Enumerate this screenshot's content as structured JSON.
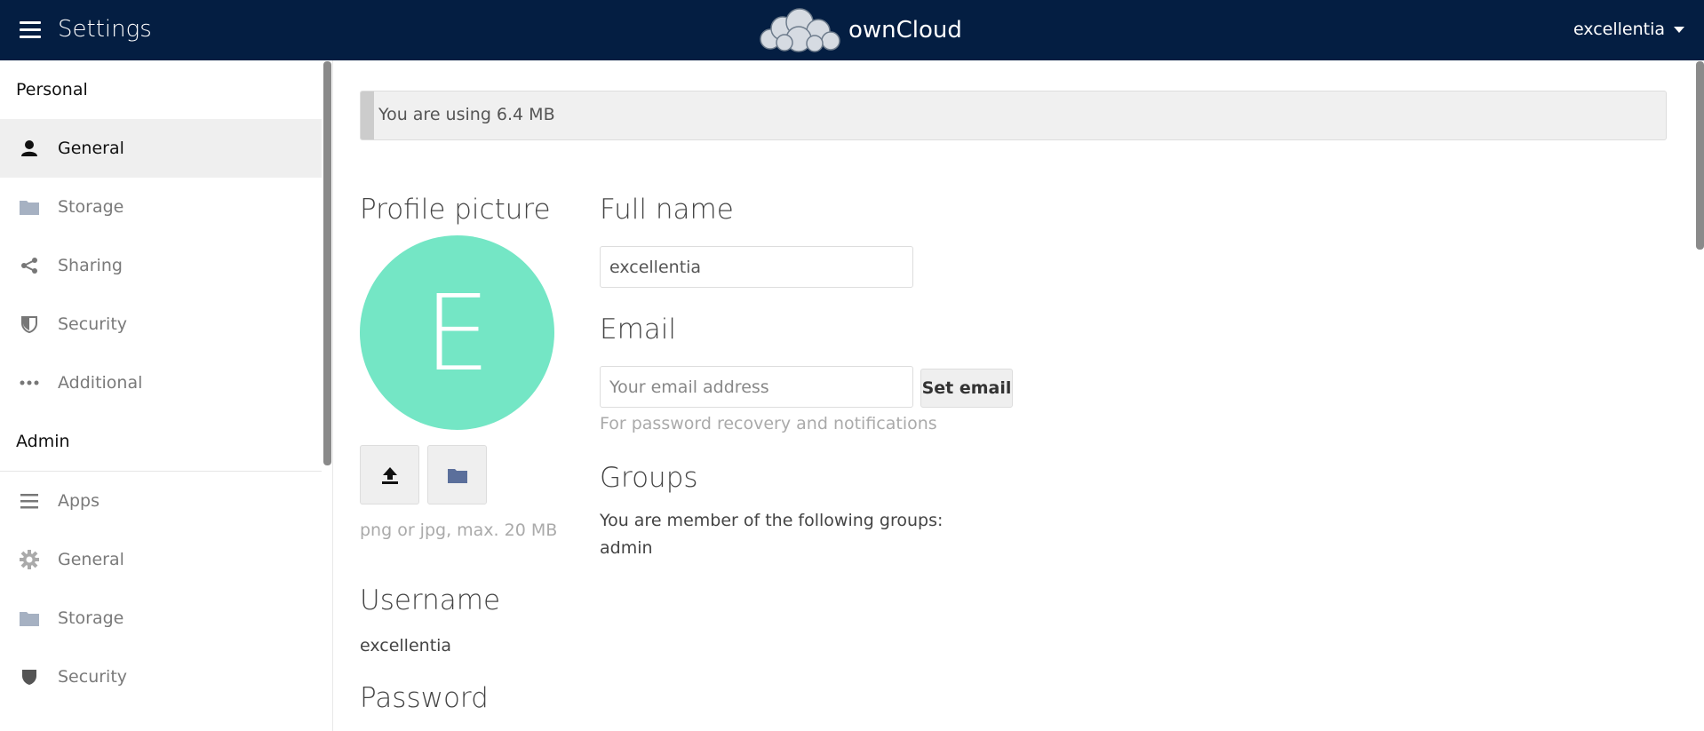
{
  "header": {
    "title": "Settings",
    "logo_text": "ownCloud",
    "user": "excellentia"
  },
  "sidebar": {
    "personal_title": "Personal",
    "personal_items": [
      {
        "label": "General",
        "icon": "user-icon",
        "active": true
      },
      {
        "label": "Storage",
        "icon": "folder-icon"
      },
      {
        "label": "Sharing",
        "icon": "share-icon"
      },
      {
        "label": "Security",
        "icon": "shield-icon"
      },
      {
        "label": "Additional",
        "icon": "more-icon"
      }
    ],
    "admin_title": "Admin",
    "admin_items": [
      {
        "label": "Apps",
        "icon": "list-icon"
      },
      {
        "label": "General",
        "icon": "gear-icon"
      },
      {
        "label": "Storage",
        "icon": "folder-icon"
      },
      {
        "label": "Security",
        "icon": "shield-icon"
      }
    ]
  },
  "main": {
    "quota_text": "You are using 6.4 MB",
    "profile_picture": {
      "title": "Profile picture",
      "initial": "E",
      "avatar_color": "#74e6c5",
      "hint": "png or jpg, max. 20 MB"
    },
    "username": {
      "title": "Username",
      "value": "excellentia"
    },
    "password": {
      "title": "Password"
    },
    "full_name": {
      "title": "Full name",
      "value": "excellentia"
    },
    "email": {
      "title": "Email",
      "placeholder": "Your email address",
      "button": "Set email",
      "hint": "For password recovery and notifications"
    },
    "groups": {
      "title": "Groups",
      "text": "You are member of the following groups:",
      "value": "admin"
    }
  },
  "colors": {
    "header_bg": "#041e42",
    "accent_folder": "#5b6f9b"
  }
}
